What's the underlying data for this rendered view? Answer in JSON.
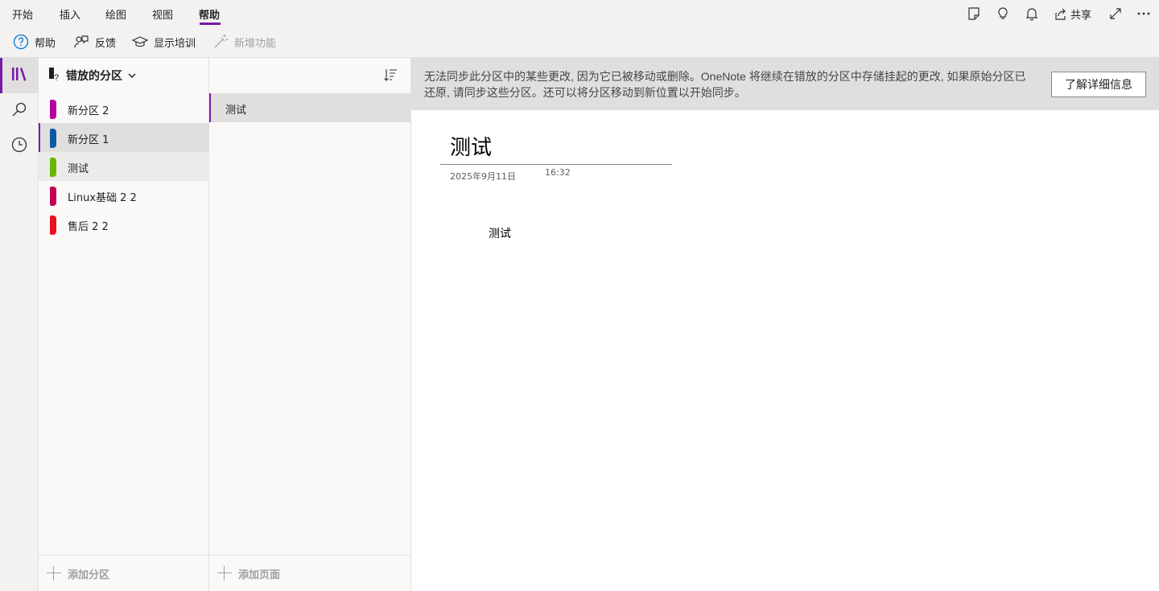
{
  "ribbon": {
    "tabs": [
      "开始",
      "插入",
      "绘图",
      "视图",
      "帮助"
    ],
    "active_tab": "帮助",
    "share_label": "共享",
    "commands": {
      "help": "帮助",
      "feedback": "反馈",
      "training": "显示培训",
      "whats_new": "新增功能"
    },
    "accent_color": "#7719aa"
  },
  "rail": {
    "items": [
      "notebooks-icon",
      "search-icon",
      "recent-icon"
    ]
  },
  "sections": {
    "notebook_title": "错放的分区",
    "items": [
      {
        "label": "新分区 2",
        "color": "#b4009e"
      },
      {
        "label": "新分区 1",
        "color": "#0f5aa8"
      },
      {
        "label": "测试",
        "color": "#6bb700"
      },
      {
        "label": "Linux基础 2 2",
        "color": "#c30052"
      },
      {
        "label": "售后 2 2",
        "color": "#e81123"
      }
    ],
    "add_label": "添加分区"
  },
  "pages": {
    "items": [
      "测试"
    ],
    "add_label": "添加页面"
  },
  "infobar": {
    "message": "无法同步此分区中的某些更改, 因为它已被移动或删除。OneNote 将继续在错放的分区中存储挂起的更改, 如果原始分区已还原, 请同步这些分区。还可以将分区移动到新位置以开始同步。",
    "button": "了解详细信息"
  },
  "page": {
    "title": "测试",
    "date": "2025年9月11日",
    "time": "16:32",
    "body": "测试"
  }
}
